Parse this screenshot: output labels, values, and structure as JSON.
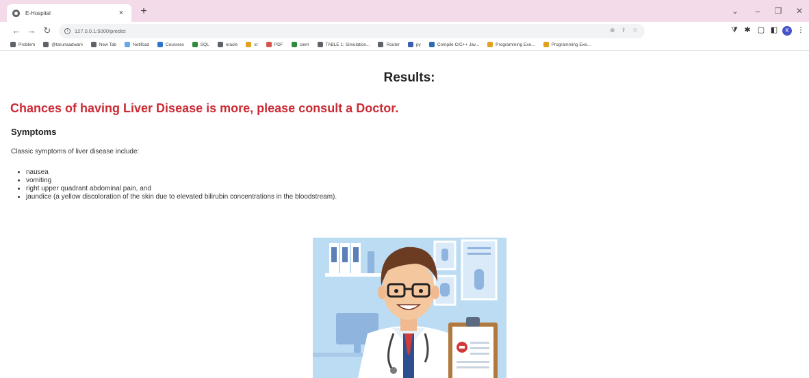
{
  "browser": {
    "tab_title": "E-Hospital",
    "tab_close": "×",
    "new_tab": "+",
    "url": "127.0.0.1:5000/predict",
    "profile_initial": "K",
    "window_controls": [
      "⌄",
      "–",
      "❐",
      "✕"
    ],
    "bookmarks": [
      {
        "label": "Problem",
        "color": "#5f6368"
      },
      {
        "label": "@tarunaadwani",
        "color": "#5f6368"
      },
      {
        "label": "New Tab",
        "color": "#5f6368"
      },
      {
        "label": "Notifcad",
        "color": "#6aa6e8"
      },
      {
        "label": "Coursera",
        "color": "#2a73cc"
      },
      {
        "label": "SQL",
        "color": "#2e8b3a"
      },
      {
        "label": "oracle",
        "color": "#5f6368"
      },
      {
        "label": "xr",
        "color": "#e0a21b"
      },
      {
        "label": "PDF",
        "color": "#d9534f"
      },
      {
        "label": "clem",
        "color": "#2e8b3a"
      },
      {
        "label": "TABLE 1: Simulation...",
        "color": "#5f6368"
      },
      {
        "label": "Router",
        "color": "#5f6368"
      },
      {
        "label": "py",
        "color": "#3a5fb0"
      },
      {
        "label": "Compile C/C++ Jav...",
        "color": "#2d6bb5"
      },
      {
        "label": "Programming Exe...",
        "color": "#e0a21b"
      },
      {
        "label": "Programming Exe...",
        "color": "#e0a21b"
      }
    ]
  },
  "page": {
    "results_title": "Results:",
    "alert": "Chances of having Liver Disease is more, please consult a Doctor.",
    "symptoms_heading": "Symptoms",
    "intro": "Classic symptoms of liver disease include:",
    "symptoms": [
      "nausea",
      "vomiting",
      "right upper quadrant abdominal pain, and",
      "jaundice (a yellow discoloration of the skin due to elevated bilirubin concentrations in the bloodstream)."
    ]
  },
  "colors": {
    "tabbar_bg": "#f4dbe9",
    "alert_red": "#cc2b34",
    "illustration_bg": "#bcdcf3"
  }
}
